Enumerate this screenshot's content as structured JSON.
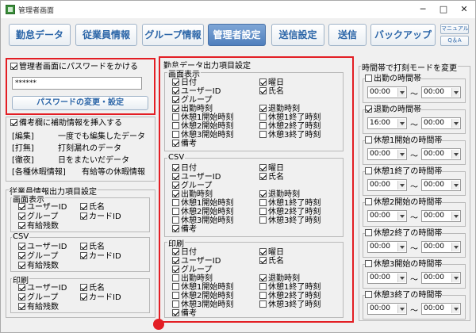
{
  "window": {
    "title": "管理者画面",
    "min": "─",
    "max": "□",
    "close": "✕"
  },
  "tabs": [
    {
      "label": "勤怠データ"
    },
    {
      "label": "従業員情報"
    },
    {
      "label": "グループ情報"
    },
    {
      "label": "管理者設定"
    },
    {
      "label": "送信設定"
    },
    {
      "label": "送信"
    },
    {
      "label": "バックアップ"
    }
  ],
  "small_buttons": {
    "manual": "マニュアル",
    "qa": "Q＆A"
  },
  "password": {
    "checkbox_label": "管理者画面にパスワードをかける",
    "value": "******",
    "change_button": "パスワードの変更・設定"
  },
  "notes": {
    "checkbox_label": "備考欄に補助情報を挿入する",
    "rows": [
      {
        "key": "[編集]",
        "text": "一度でも編集したデータ"
      },
      {
        "key": "[打無]",
        "text": "打刻漏れのデータ"
      },
      {
        "key": "[徹夜]",
        "text": "日をまたいだデータ"
      },
      {
        "key": "[各種休暇情報]",
        "text": "有給等の休暇情報"
      }
    ]
  },
  "employee_output": {
    "title": "従業員情報出力項目設定",
    "sections": [
      {
        "title": "画面表示",
        "left": [
          "ユーザーID",
          "グループ",
          "有給残数"
        ],
        "right": [
          "氏名",
          "カードID"
        ]
      },
      {
        "title": "CSV",
        "left": [
          "ユーザーID",
          "グループ",
          "有給残数"
        ],
        "right": [
          "氏名",
          "カードID"
        ]
      },
      {
        "title": "印刷",
        "left": [
          "ユーザーID",
          "グループ",
          "有給残数"
        ],
        "right": [
          "氏名",
          "カードID"
        ]
      }
    ]
  },
  "attendance_output": {
    "title": "勤怠データ出力項目設定",
    "sections": [
      {
        "title": "画面表示",
        "left": [
          "日付",
          "ユーザーID",
          "グループ",
          "出勤時刻",
          "休憩1開始時刻",
          "休憩2開始時刻",
          "休憩3開始時刻",
          "備考"
        ],
        "left_checked": [
          true,
          true,
          true,
          true,
          false,
          false,
          false,
          true
        ],
        "right": [
          "曜日",
          "氏名",
          "",
          "退勤時刻",
          "休憩1終了時刻",
          "休憩2終了時刻",
          "休憩3終了時刻"
        ],
        "right_checked": [
          true,
          true,
          false,
          true,
          false,
          false,
          false
        ]
      },
      {
        "title": "CSV",
        "left": [
          "日付",
          "ユーザーID",
          "グループ",
          "出勤時刻",
          "休憩1開始時刻",
          "休憩2開始時刻",
          "休憩3開始時刻",
          "備考"
        ],
        "left_checked": [
          true,
          true,
          true,
          true,
          false,
          false,
          false,
          true
        ],
        "right": [
          "曜日",
          "氏名",
          "",
          "退勤時刻",
          "休憩1終了時刻",
          "休憩2終了時刻",
          "休憩3終了時刻"
        ],
        "right_checked": [
          true,
          true,
          false,
          true,
          false,
          false,
          false
        ]
      },
      {
        "title": "印刷",
        "left": [
          "日付",
          "ユーザーID",
          "グループ",
          "出勤時刻",
          "休憩1開始時刻",
          "休憩2開始時刻",
          "休憩3開始時刻",
          "備考"
        ],
        "left_checked": [
          true,
          true,
          true,
          false,
          false,
          false,
          false,
          true
        ],
        "right": [
          "曜日",
          "氏名",
          "",
          "退勤時刻",
          "休憩1終了時刻",
          "休憩2終了時刻",
          "休憩3終了時刻"
        ],
        "right_checked": [
          true,
          true,
          false,
          true,
          false,
          false,
          false
        ]
      }
    ]
  },
  "time_mode": {
    "title": "時間帯で打刻モードを変更",
    "rows": [
      {
        "label": "出勤の時間帯",
        "checked": false,
        "from": "00:00",
        "to": "00:00"
      },
      {
        "label": "退勤の時間帯",
        "checked": true,
        "from": "16:00",
        "to": "00:00"
      },
      {
        "label": "休憩1開始の時間帯",
        "checked": false,
        "from": "00:00",
        "to": "00:00"
      },
      {
        "label": "休憩1終了の時間帯",
        "checked": false,
        "from": "00:00",
        "to": "00:00"
      },
      {
        "label": "休憩2開始の時間帯",
        "checked": false,
        "from": "00:00",
        "to": "00:00"
      },
      {
        "label": "休憩2終了の時間帯",
        "checked": false,
        "from": "00:00",
        "to": "00:00"
      },
      {
        "label": "休憩3開始の時間帯",
        "checked": false,
        "from": "00:00",
        "to": "00:00"
      },
      {
        "label": "休憩3終了の時間帯",
        "checked": false,
        "from": "00:00",
        "to": "00:00"
      }
    ],
    "tilde": "～"
  },
  "colors": {
    "accent": "#2c66a8",
    "active_tab": "#5b89c6",
    "highlight": "#e31e24"
  }
}
